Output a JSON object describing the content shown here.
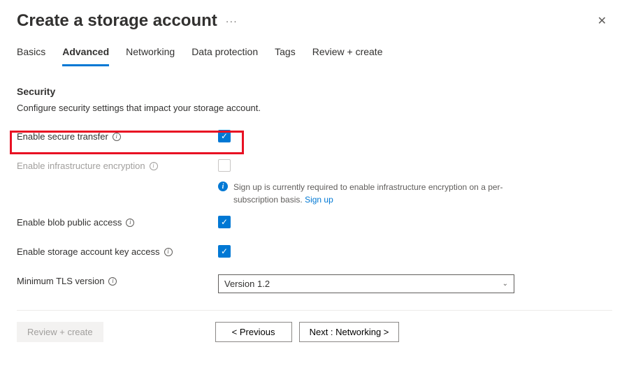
{
  "header": {
    "title": "Create a storage account",
    "more": "···"
  },
  "tabs": {
    "basics": "Basics",
    "advanced": "Advanced",
    "networking": "Networking",
    "dataProtection": "Data protection",
    "tags": "Tags",
    "reviewCreate": "Review + create"
  },
  "section": {
    "title": "Security",
    "desc": "Configure security settings that impact your storage account."
  },
  "fields": {
    "secureTransfer": {
      "label": "Enable secure transfer",
      "checked": true
    },
    "infraEncryption": {
      "label": "Enable infrastructure encryption",
      "checked": false,
      "info": "Sign up is currently required to enable infrastructure encryption on a per-subscription basis.",
      "signup": "Sign up"
    },
    "blobPublic": {
      "label": "Enable blob public access",
      "checked": true
    },
    "keyAccess": {
      "label": "Enable storage account key access",
      "checked": true
    },
    "tls": {
      "label": "Minimum TLS version",
      "value": "Version 1.2"
    }
  },
  "footer": {
    "reviewCreate": "Review + create",
    "previous": "< Previous",
    "next": "Next : Networking >"
  }
}
